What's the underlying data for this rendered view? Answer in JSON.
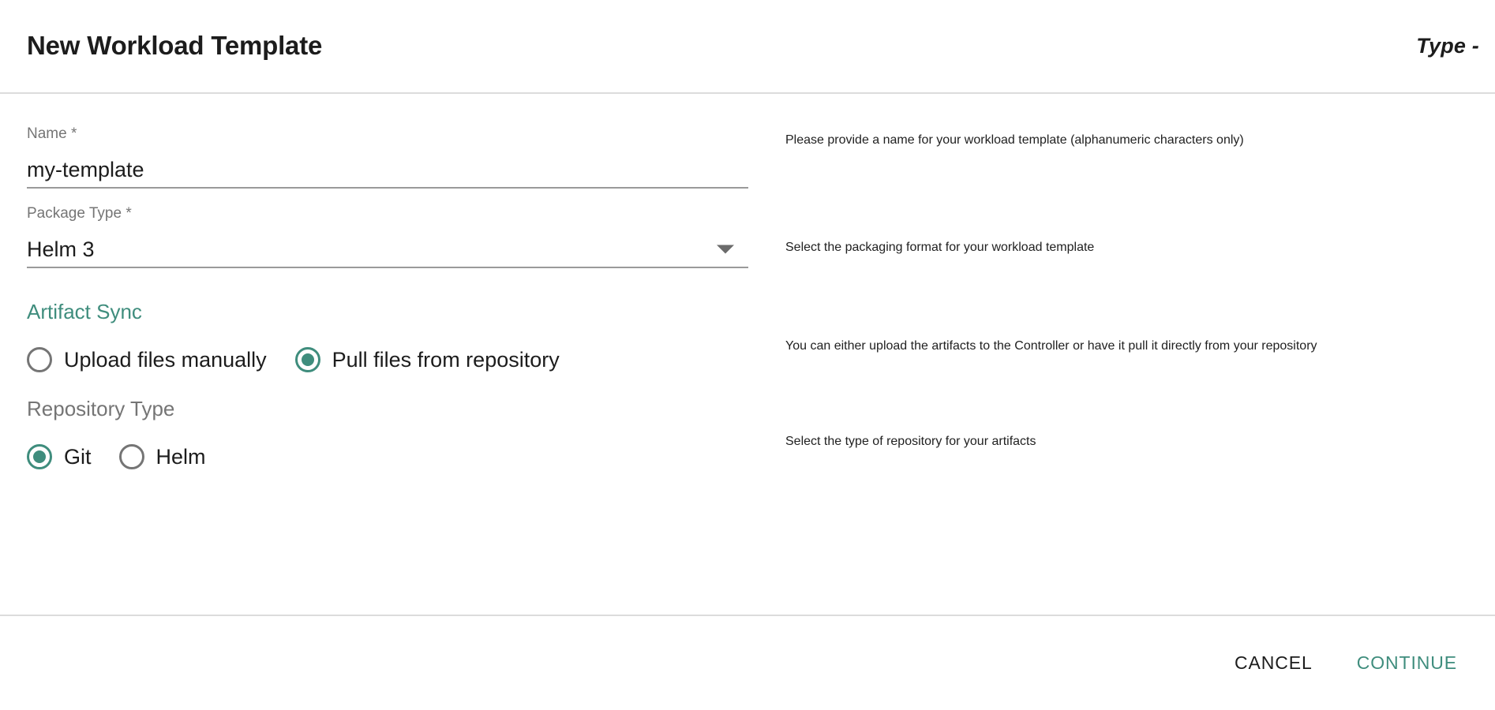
{
  "header": {
    "title": "New Workload Template",
    "type_label": "Type -"
  },
  "form": {
    "name_field": {
      "label": "Name *",
      "value": "my-template",
      "placeholder": "Name",
      "helper": "Please provide a name for your workload template (alphanumeric characters only)"
    },
    "package_type_field": {
      "label": "Package Type *",
      "value": "Helm 3",
      "helper": "Select the packaging format for your workload template",
      "dropdown_icon": "chevron-down-icon",
      "options": [
        "Helm 3"
      ]
    },
    "artifact_sync": {
      "heading": "Artifact Sync",
      "helper": "You can either upload the artifacts to the Controller or have it pull it directly from your repository",
      "options": [
        {
          "label": "Upload files manually",
          "selected": false
        },
        {
          "label": "Pull files from repository",
          "selected": true
        }
      ]
    },
    "repository_type": {
      "heading": "Repository Type",
      "helper": "Select the type of repository for your artifacts",
      "options": [
        {
          "label": "Git",
          "selected": true
        },
        {
          "label": "Helm",
          "selected": false
        }
      ]
    }
  },
  "footer": {
    "cancel_label": "CANCEL",
    "continue_label": "CONTINUE"
  },
  "colors": {
    "accent": "#3f8d7d",
    "text": "#1c1c1c",
    "muted": "#757575",
    "helper": "#8a8a8a",
    "divider": "#dcdcdc",
    "underline": "#9a9a9a"
  }
}
